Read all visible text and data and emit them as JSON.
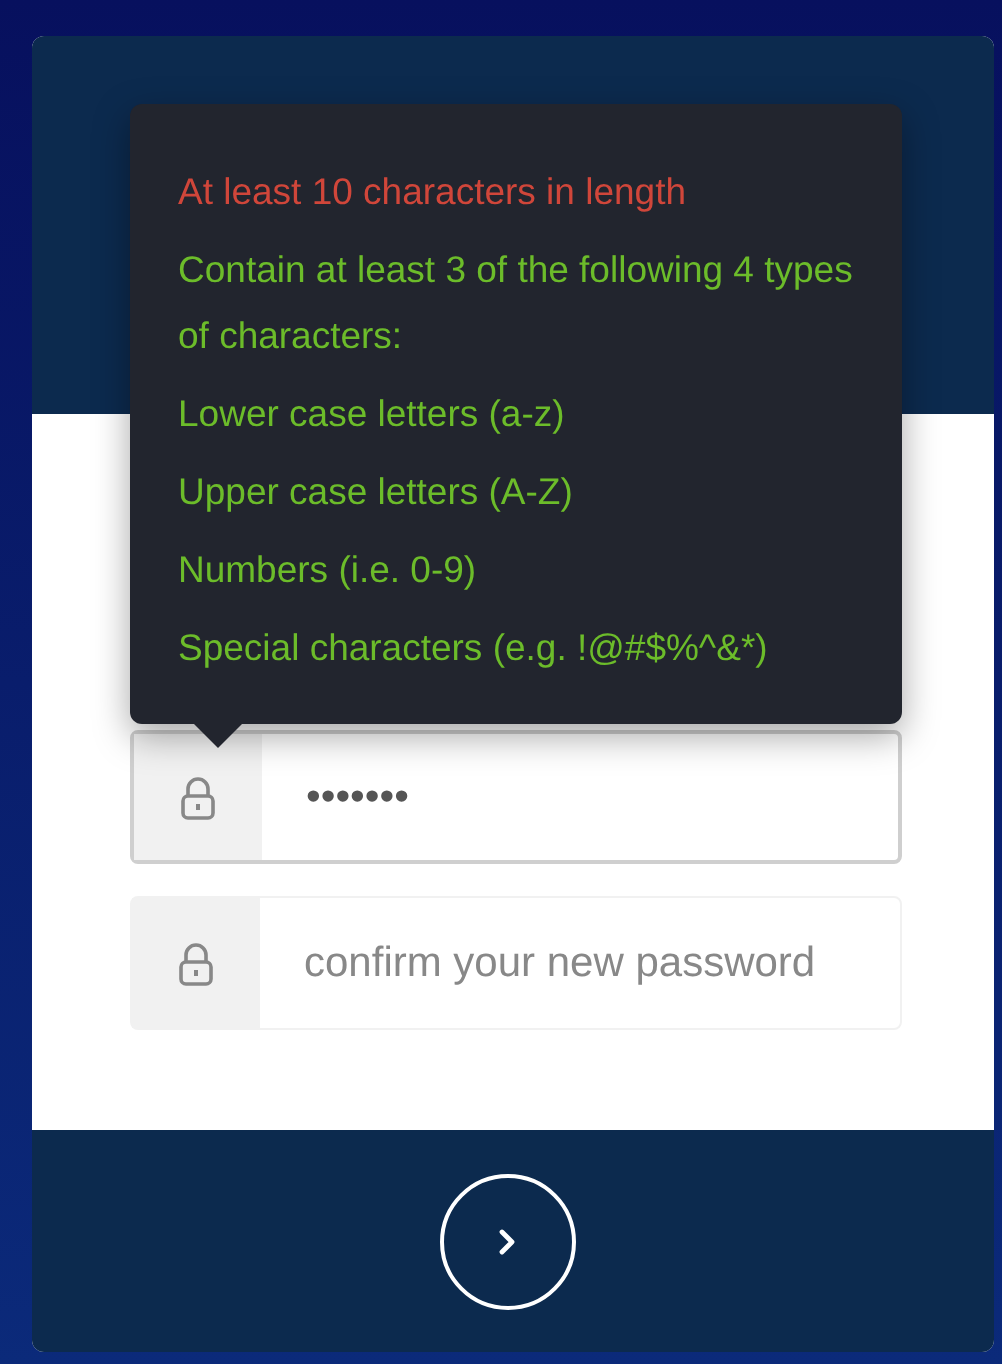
{
  "password_rules": [
    {
      "text": "At least 10 characters in length",
      "met": false
    },
    {
      "text": "Contain at least 3 of the following 4 types of characters:",
      "met": true
    },
    {
      "text": "Lower case letters (a-z)",
      "met": true
    },
    {
      "text": "Upper case letters (A-Z)",
      "met": true
    },
    {
      "text": "Numbers (i.e. 0-9)",
      "met": true
    },
    {
      "text": "Special characters (e.g. !@#$%^&*)",
      "met": true
    }
  ],
  "fields": [
    {
      "kind": "password",
      "value": "•••••••",
      "focused": true
    },
    {
      "kind": "password",
      "placeholder": "confirm your new password",
      "focused": false
    }
  ]
}
